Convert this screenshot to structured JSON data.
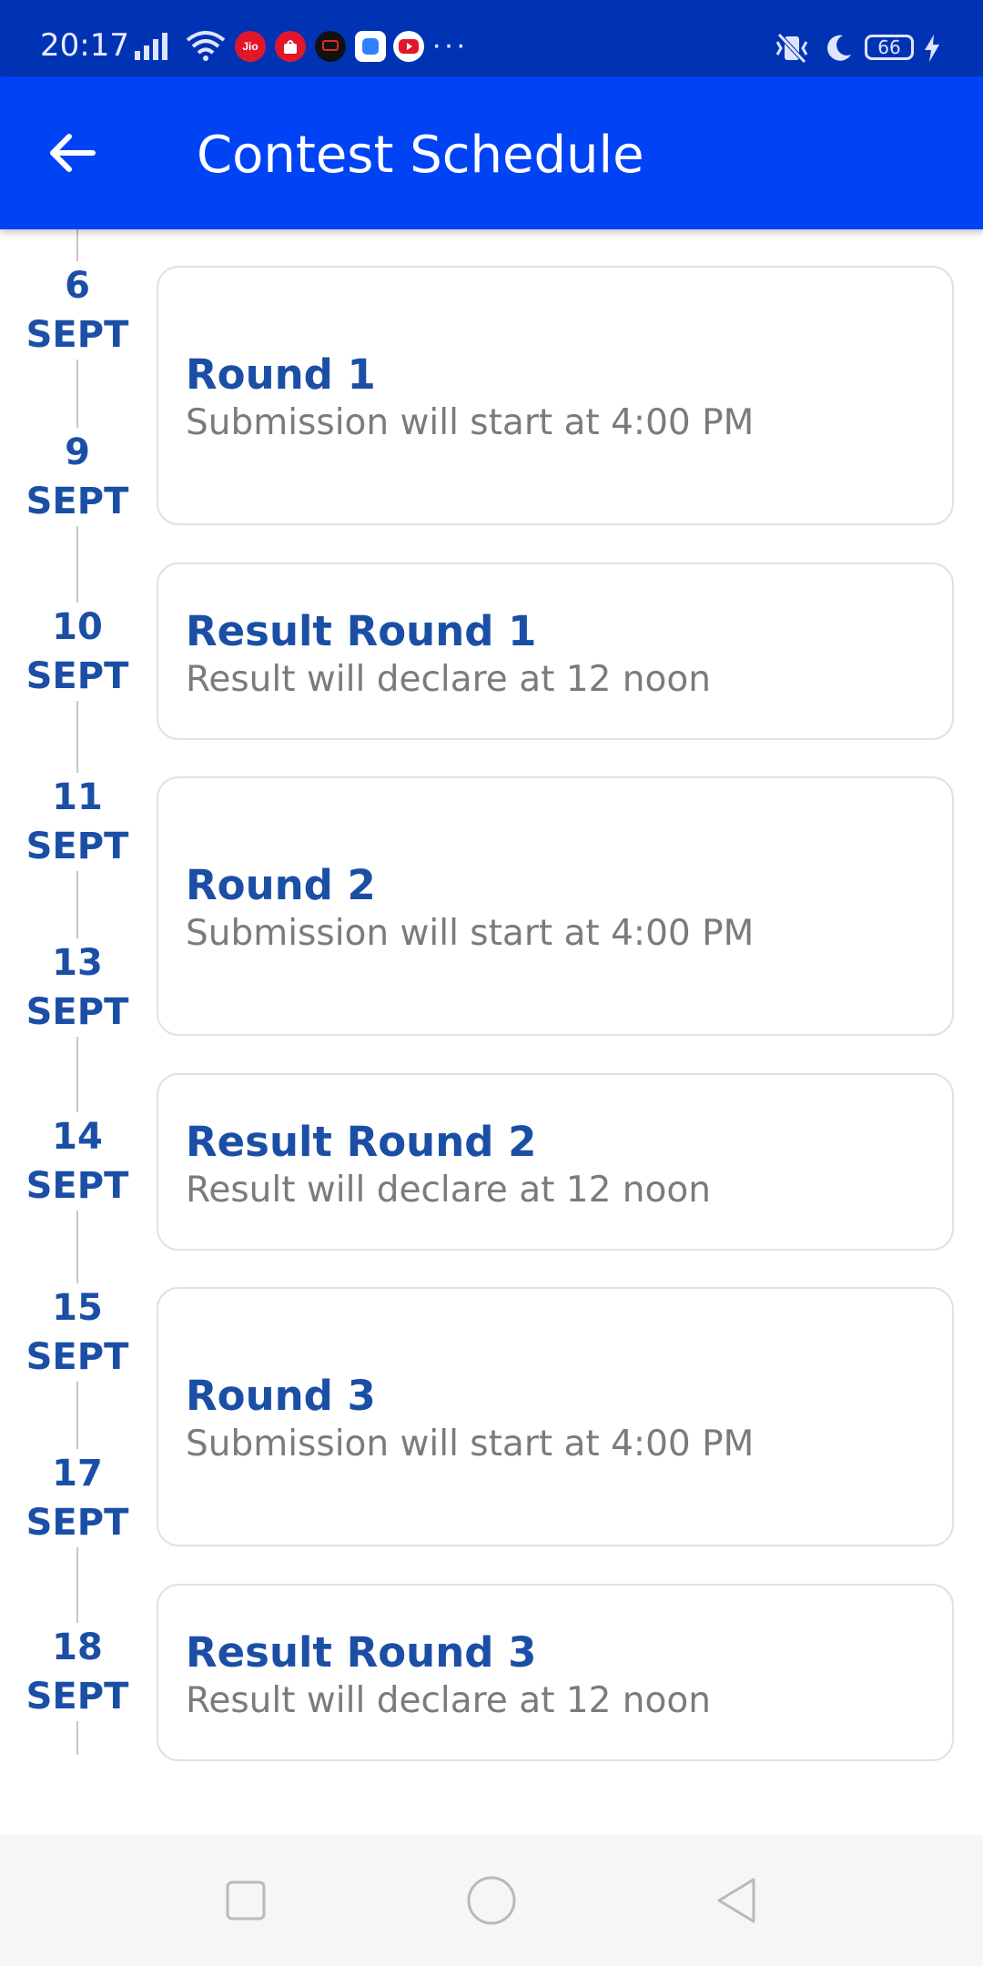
{
  "status_bar": {
    "time": "20:17",
    "battery": "66",
    "more": "···",
    "carrier_icon_text": "Jio"
  },
  "app_bar": {
    "title": "Contest Schedule",
    "back_icon": "arrow-left-icon"
  },
  "schedule": [
    {
      "dates": [
        {
          "day": "6",
          "month": "SEPT"
        },
        {
          "day": "9",
          "month": "SEPT"
        }
      ],
      "title": "Round 1",
      "subtitle": "Submission will start at 4:00 PM"
    },
    {
      "dates": [
        {
          "day": "10",
          "month": "SEPT"
        }
      ],
      "title": "Result Round 1",
      "subtitle": "Result will declare at 12 noon"
    },
    {
      "dates": [
        {
          "day": "11",
          "month": "SEPT"
        },
        {
          "day": "13",
          "month": "SEPT"
        }
      ],
      "title": "Round 2",
      "subtitle": "Submission will start at 4:00 PM"
    },
    {
      "dates": [
        {
          "day": "14",
          "month": "SEPT"
        }
      ],
      "title": "Result Round 2",
      "subtitle": "Result will declare at 12 noon"
    },
    {
      "dates": [
        {
          "day": "15",
          "month": "SEPT"
        },
        {
          "day": "17",
          "month": "SEPT"
        }
      ],
      "title": "Round 3",
      "subtitle": "Submission will start at 4:00 PM"
    },
    {
      "dates": [
        {
          "day": "18",
          "month": "SEPT"
        }
      ],
      "title": "Result Round 3",
      "subtitle": "Result will declare at 12 noon"
    }
  ],
  "nav_bar": {
    "recent_icon": "square-icon",
    "home_icon": "circle-icon",
    "back_icon": "triangle-back-icon"
  },
  "colors": {
    "status_bar": "#0033b4",
    "app_bar": "#0043f5",
    "accent_text": "#1b4fa6",
    "secondary_text": "#7b7b7b"
  }
}
